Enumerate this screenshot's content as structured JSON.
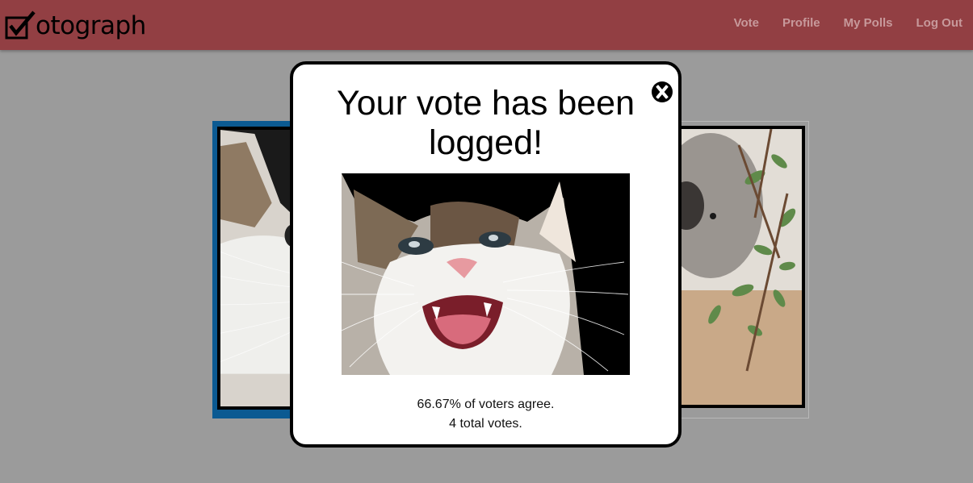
{
  "app": {
    "brand_text": "otograph",
    "brand_icon": "checkbox-checked-icon"
  },
  "nav": {
    "items": [
      "Vote",
      "Profile",
      "My Polls",
      "Log Out"
    ]
  },
  "modal": {
    "title": "Your vote has been logged!",
    "stat_agree": "66.67% of voters agree.",
    "stat_total": "4 total votes.",
    "close_label": "X"
  },
  "colors": {
    "header_bg": "#923f43",
    "nav_text": "#c7999b",
    "page_bg": "#9b9b9b",
    "selected_card_border": "#0b5a92"
  }
}
